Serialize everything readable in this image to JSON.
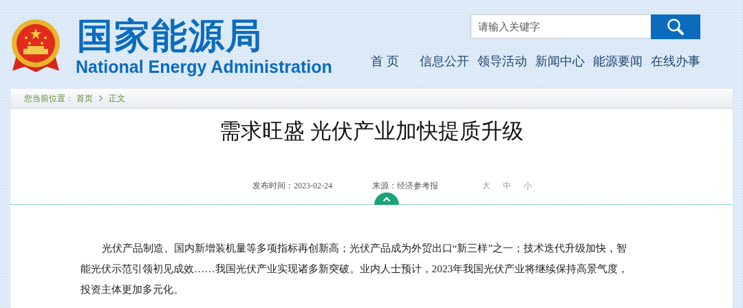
{
  "header": {
    "site_name": "国家能源局",
    "site_name_en": "National Energy Administration",
    "search": {
      "placeholder": "请输入关键字"
    },
    "nav": [
      "首 页",
      "信息公开",
      "领导活动",
      "新闻中心",
      "能源要闻",
      "在线办事"
    ]
  },
  "breadcrumb": {
    "label": "您当前位置：",
    "items": [
      "首页",
      "正文"
    ]
  },
  "article": {
    "title": "需求旺盛 光伏产业加快提质升级",
    "meta": [
      "发布时间：2023-02-24",
      "来源：经济参考报"
    ],
    "font_sizes": [
      {
        "label": "大",
        "selected": false
      },
      {
        "label": "中",
        "selected": false
      },
      {
        "label": "小",
        "selected": false
      }
    ],
    "paragraphs": [
      "光伏产品制造、国内新增装机量等多项指标再创新高；光伏产品成为外贸出口“新三样”之一；技术迭代升级加快，智能光伏示范引领初见成效……我国光伏产业实现诸多新突破。业内人士预计，2023年我国光伏产业将继续保持高景气度，投资主体更加多元化。"
    ]
  }
}
